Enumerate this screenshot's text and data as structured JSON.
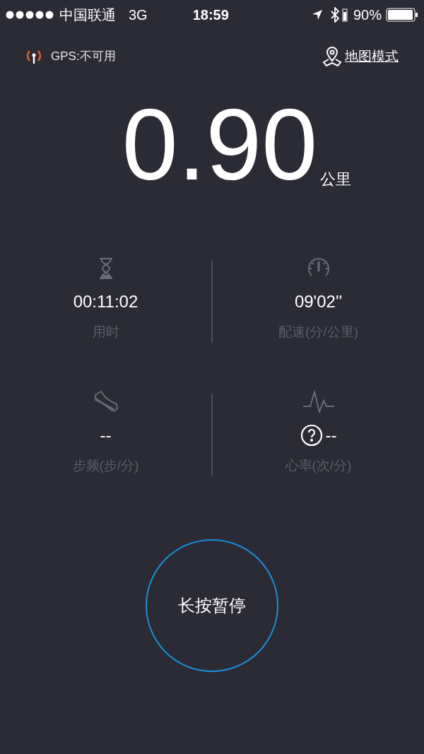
{
  "status_bar": {
    "carrier": "中国联通",
    "network": "3G",
    "time": "18:59",
    "battery": "90%"
  },
  "top_bar": {
    "gps": "GPS:不可用",
    "map_mode": "地图模式"
  },
  "distance": {
    "value": "0.90",
    "unit": "公里"
  },
  "stats": [
    {
      "kind": "time",
      "value": "00:11:02",
      "label": "用时"
    },
    {
      "kind": "pace",
      "value": "09'02''",
      "label": "配速(分/公里)"
    },
    {
      "kind": "cadence",
      "value": "--",
      "label": "步频(步/分)"
    },
    {
      "kind": "heart",
      "value": "--",
      "label": "心率(次/分)"
    }
  ],
  "pause_button": "长按暂停"
}
